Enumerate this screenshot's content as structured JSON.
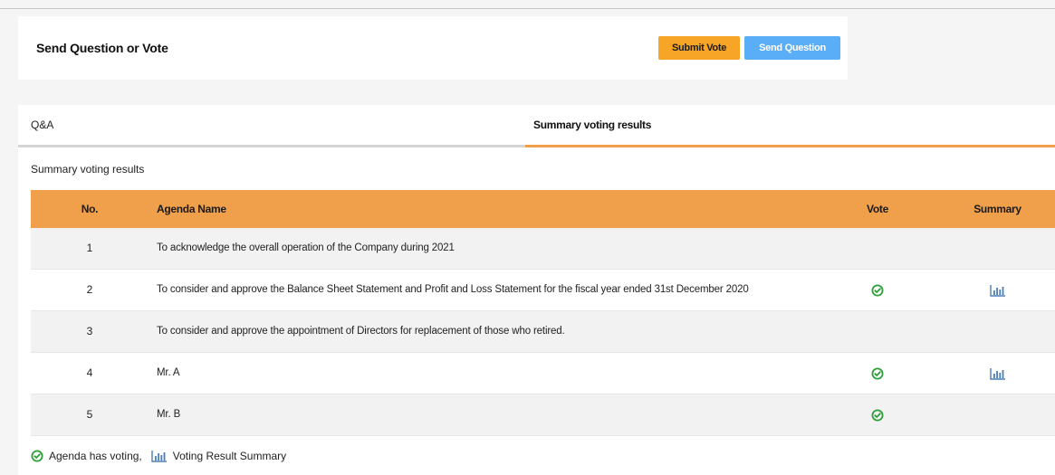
{
  "header": {
    "title": "Send Question or Vote",
    "submit_vote_label": "Submit Vote",
    "send_question_label": "Send Question"
  },
  "tabs": [
    {
      "label": "Q&A",
      "active": false
    },
    {
      "label": "Summary voting results",
      "active": true
    }
  ],
  "section_title": "Summary voting results",
  "table": {
    "columns": [
      "No.",
      "Agenda Name",
      "Vote",
      "Summary"
    ],
    "rows": [
      {
        "no": "1",
        "agenda": "To acknowledge the overall operation of the Company during 2021",
        "has_vote": false,
        "has_summary": false
      },
      {
        "no": "2",
        "agenda": "To consider and approve the Balance Sheet Statement and Profit and Loss Statement for the fiscal year ended 31st December 2020",
        "has_vote": true,
        "has_summary": true
      },
      {
        "no": "3",
        "agenda": "To consider and approve the appointment of Directors for replacement of those who retired.",
        "has_vote": false,
        "has_summary": false
      },
      {
        "no": "4",
        "agenda": "Mr. A",
        "has_vote": true,
        "has_summary": true
      },
      {
        "no": "5",
        "agenda": "Mr. B",
        "has_vote": true,
        "has_summary": false
      }
    ]
  },
  "legend": {
    "vote_text": "Agenda has voting,",
    "summary_text": "Voting Result Summary"
  },
  "icons": {
    "vote": "check-circle-icon",
    "summary": "bar-chart-icon"
  },
  "colors": {
    "accent_orange": "#f0a04b",
    "submit_button": "#f7a526",
    "question_button": "#5aaef7",
    "check_green": "#2e9e3a",
    "chart_blue": "#4a7fb8"
  }
}
